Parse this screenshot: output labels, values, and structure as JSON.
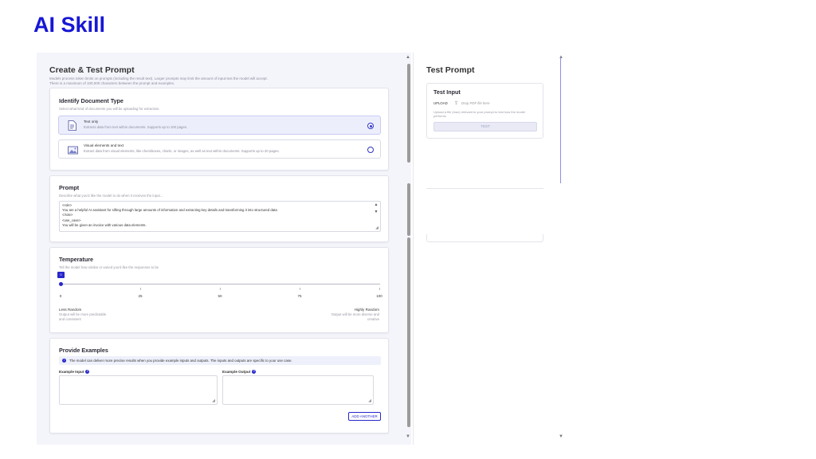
{
  "slide_title": "AI Skill",
  "left": {
    "title": "Create & Test Prompt",
    "subtitle_line1": "Models process token limits on prompts (including the result text). Larger prompts may limit the amount of input text the model will accept.",
    "subtitle_line2": "There is a maximum of 100,000 characters between the prompt and examples.",
    "doc_type": {
      "title": "Identify Document Type",
      "desc": "Select what kind of documents you will be uploading for extraction.",
      "options": [
        {
          "title": "Text only",
          "desc": "Extracts data from text within documents. Supports up to 100 pages.",
          "selected": true,
          "icon": "document-icon"
        },
        {
          "title": "Visual elements and text",
          "desc": "Extract data from visual elements, like checkboxes, charts, or images, as well as text within documents. Supports up to 20 pages.",
          "selected": false,
          "icon": "image-icon"
        }
      ]
    },
    "prompt": {
      "title": "Prompt",
      "desc": "Describe what you'd like the model to do when it receives the input...",
      "lines": [
        "<role>",
        "You are a helpful AI assistant for sifting through large amounts of information and extracting key details and transforming it into structured data",
        "</role>",
        "<use_case>",
        "You will be given an invoice with various data elements."
      ]
    },
    "temperature": {
      "title": "Temperature",
      "desc": "Tell the model how similar or varied you'd like the responses to be",
      "value": 0,
      "ticks": [
        "0",
        "25",
        "50",
        "75",
        "100"
      ],
      "low_label": "Less Random",
      "low_hint_1": "Output will be more predictable",
      "low_hint_2": "and consistent",
      "high_label": "Highly Random",
      "high_hint_1": "Output will be more diverse and",
      "high_hint_2": "creative"
    },
    "examples": {
      "title": "Provide Examples",
      "info": "The model can deliver more precise results when you provide example inputs and outputs. The inputs and outputs are specific to your use case.",
      "input_label": "Example Input",
      "output_label": "Example Output",
      "add_button": "ADD ANOTHER"
    }
  },
  "right": {
    "title": "Test Prompt",
    "test_input": {
      "title": "Test Input",
      "upload_label": "UPLOAD",
      "drop_hint": "Drop PDF file here",
      "desc_line1": "Upload a file (max) relevant to your prompt to test how the model",
      "desc_line2": "performs",
      "test_button": "TEST"
    }
  },
  "colors": {
    "accent": "#2727cc",
    "title_blue": "#1717d6",
    "panel_bg": "#f4f5fb"
  }
}
